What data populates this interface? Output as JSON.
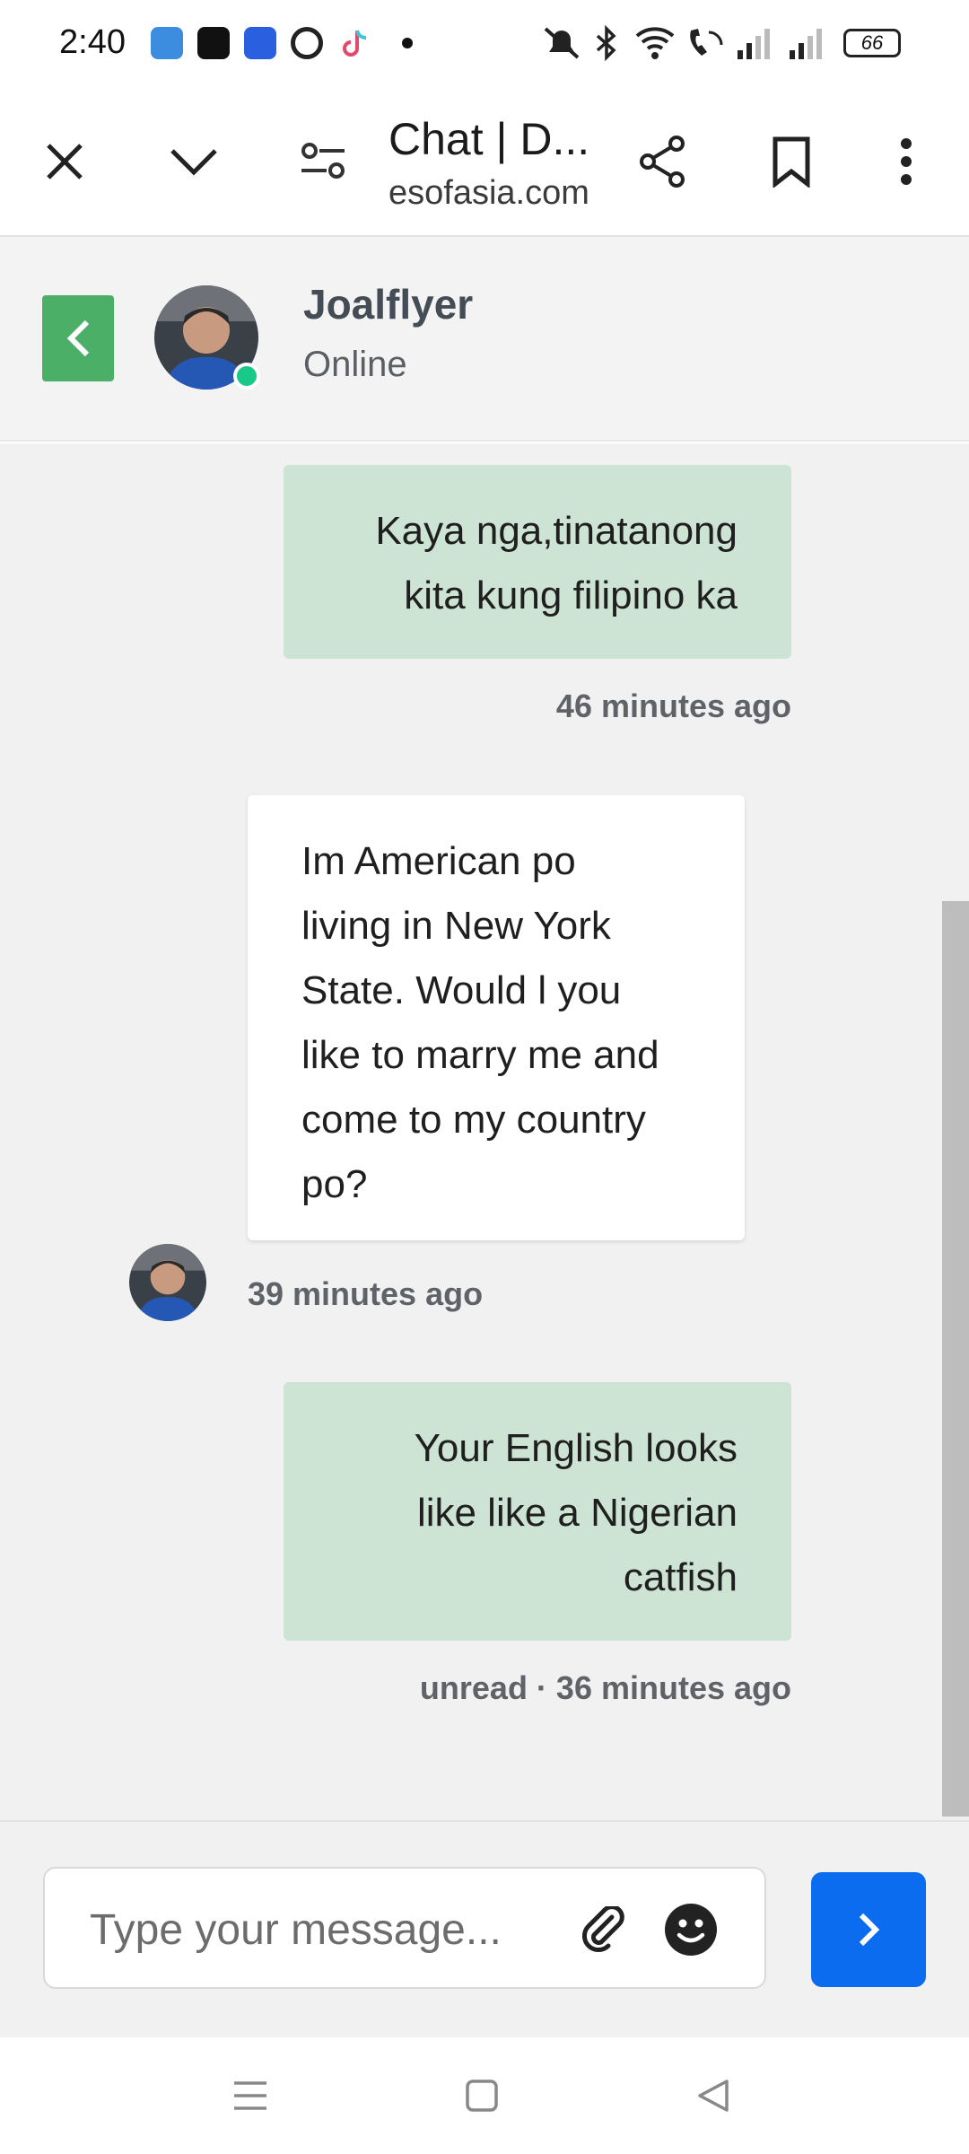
{
  "status_bar": {
    "time": "2:40",
    "battery": "66",
    "icons": [
      "app-icon-blue",
      "shopee-icon",
      "radio-icon",
      "google-icon",
      "tiktok-icon",
      "dot-icon",
      "mute-icon",
      "bluetooth-icon",
      "wifi-icon",
      "wifi-call-icon",
      "signal-icon",
      "signal-icon",
      "battery-icon"
    ]
  },
  "browser": {
    "title": "Chat | D...",
    "url": "esofasia.com"
  },
  "chat_header": {
    "name": "Joalflyer",
    "status": "Online",
    "accent": "#4caf68",
    "online_color": "#18c98a"
  },
  "messages": [
    {
      "direction": "outgoing",
      "lines": [
        "Kaya nga,tinatanong",
        "kita kung filipino ka"
      ],
      "meta": "46 minutes ago"
    },
    {
      "direction": "incoming",
      "lines": [
        "Im American po",
        "living in New York",
        "State. Would l you",
        "like to marry me and",
        "come to my country",
        "po?"
      ],
      "meta": "39 minutes ago"
    },
    {
      "direction": "outgoing",
      "lines": [
        "Your English looks",
        "like like a Nigerian",
        "catfish"
      ],
      "meta": "unread · 36 minutes ago"
    }
  ],
  "composer": {
    "placeholder": "Type your message...",
    "send_color": "#0b6cf0"
  }
}
